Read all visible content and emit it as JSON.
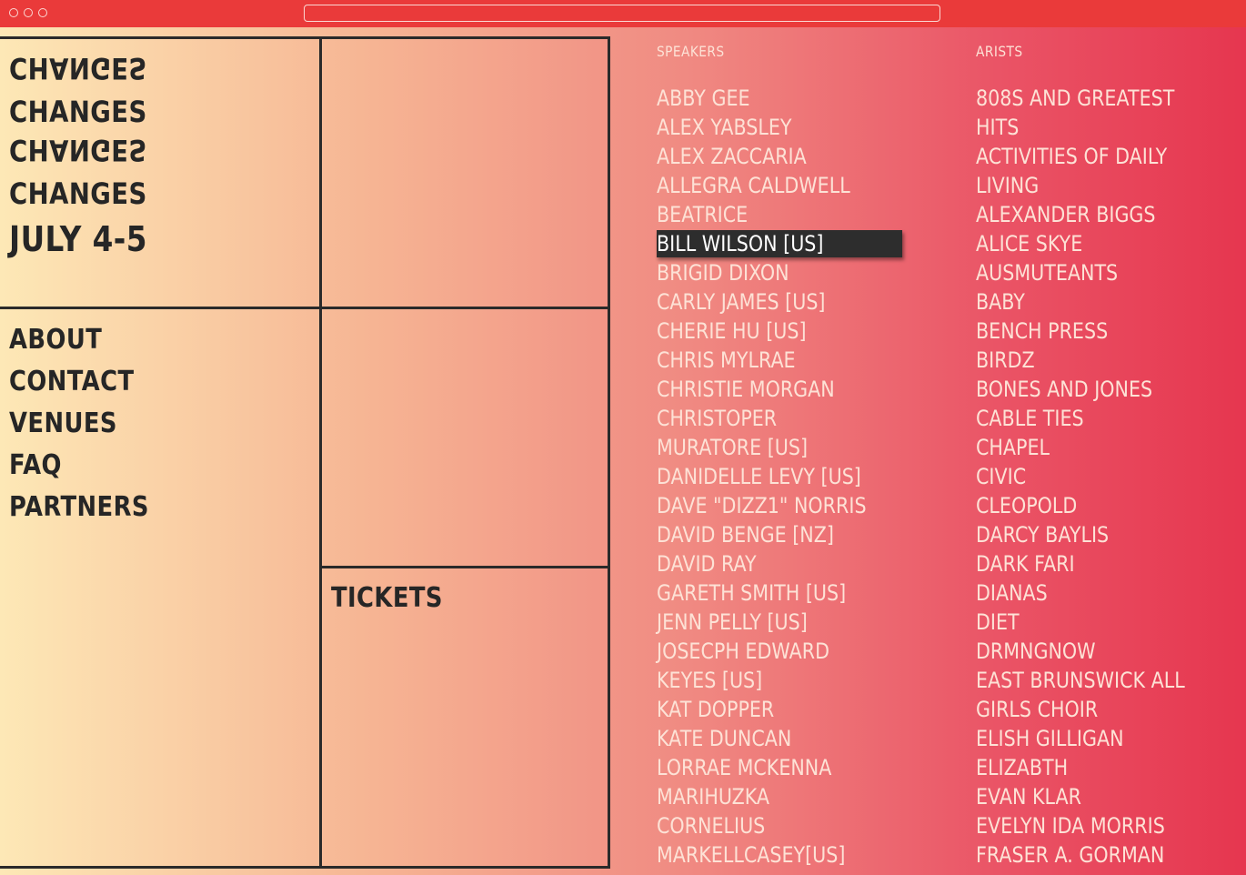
{
  "browser": {
    "url": ""
  },
  "logo": {
    "line1": "CHANGES",
    "line2": "CHANGES",
    "line3": "CHANGES",
    "line4": "CHANGES",
    "date": "JULY 4-5"
  },
  "nav": {
    "items": [
      "ABOUT",
      "CONTACT",
      "VENUES",
      "FAQ",
      "PARTNERS"
    ],
    "tickets": "TICKETS"
  },
  "speakers": {
    "heading": "SPEAKERS",
    "selected_index": 5,
    "items": [
      "ABBY GEE",
      "ALEX YABSLEY",
      "ALEX ZACCARIA",
      "ALLEGRA CALDWELL",
      "BEATRICE",
      "BILL WILSON [US]",
      "BRIGID DIXON",
      "CARLY JAMES [US]",
      "CHERIE HU [US]",
      "CHRIS MYLRAE",
      "CHRISTIE MORGAN",
      "CHRISTOPER",
      "MURATORE [US]",
      "DANIDELLE LEVY [US]",
      "DAVE \"DIZZ1\" NORRIS",
      "DAVID BENGE [NZ]",
      "DAVID RAY",
      "GARETH SMITH [US]",
      "JENN PELLY [US]",
      "JOSECPH EDWARD",
      "KEYES [US]",
      "KAT DOPPER",
      "KATE DUNCAN",
      "LORRAE MCKENNA",
      "MARIHUZKA",
      "CORNELIUS",
      "MARKELLCASEY[US]"
    ]
  },
  "artists": {
    "heading": "ARISTS",
    "items": [
      "808S AND GREATEST",
      "HITS",
      "ACTIVITIES OF DAILY",
      "LIVING",
      "ALEXANDER BIGGS",
      "ALICE SKYE",
      "AUSMUTEANTS",
      "BABY",
      "BENCH PRESS",
      "BIRDZ",
      "BONES AND JONES",
      "CABLE TIES",
      "CHAPEL",
      "CIVIC",
      "CLEOPOLD",
      "DARCY BAYLIS",
      "DARK FARI",
      "DIANAS",
      "DIET",
      "DRMNGNOW",
      "EAST BRUNSWICK ALL",
      "GIRLS CHOIR",
      "ELISH GILLIGAN",
      "ELIZABTH",
      "EVAN KLAR",
      "EVELYN IDA MORRIS",
      "FRASER A. GORMAN"
    ]
  }
}
